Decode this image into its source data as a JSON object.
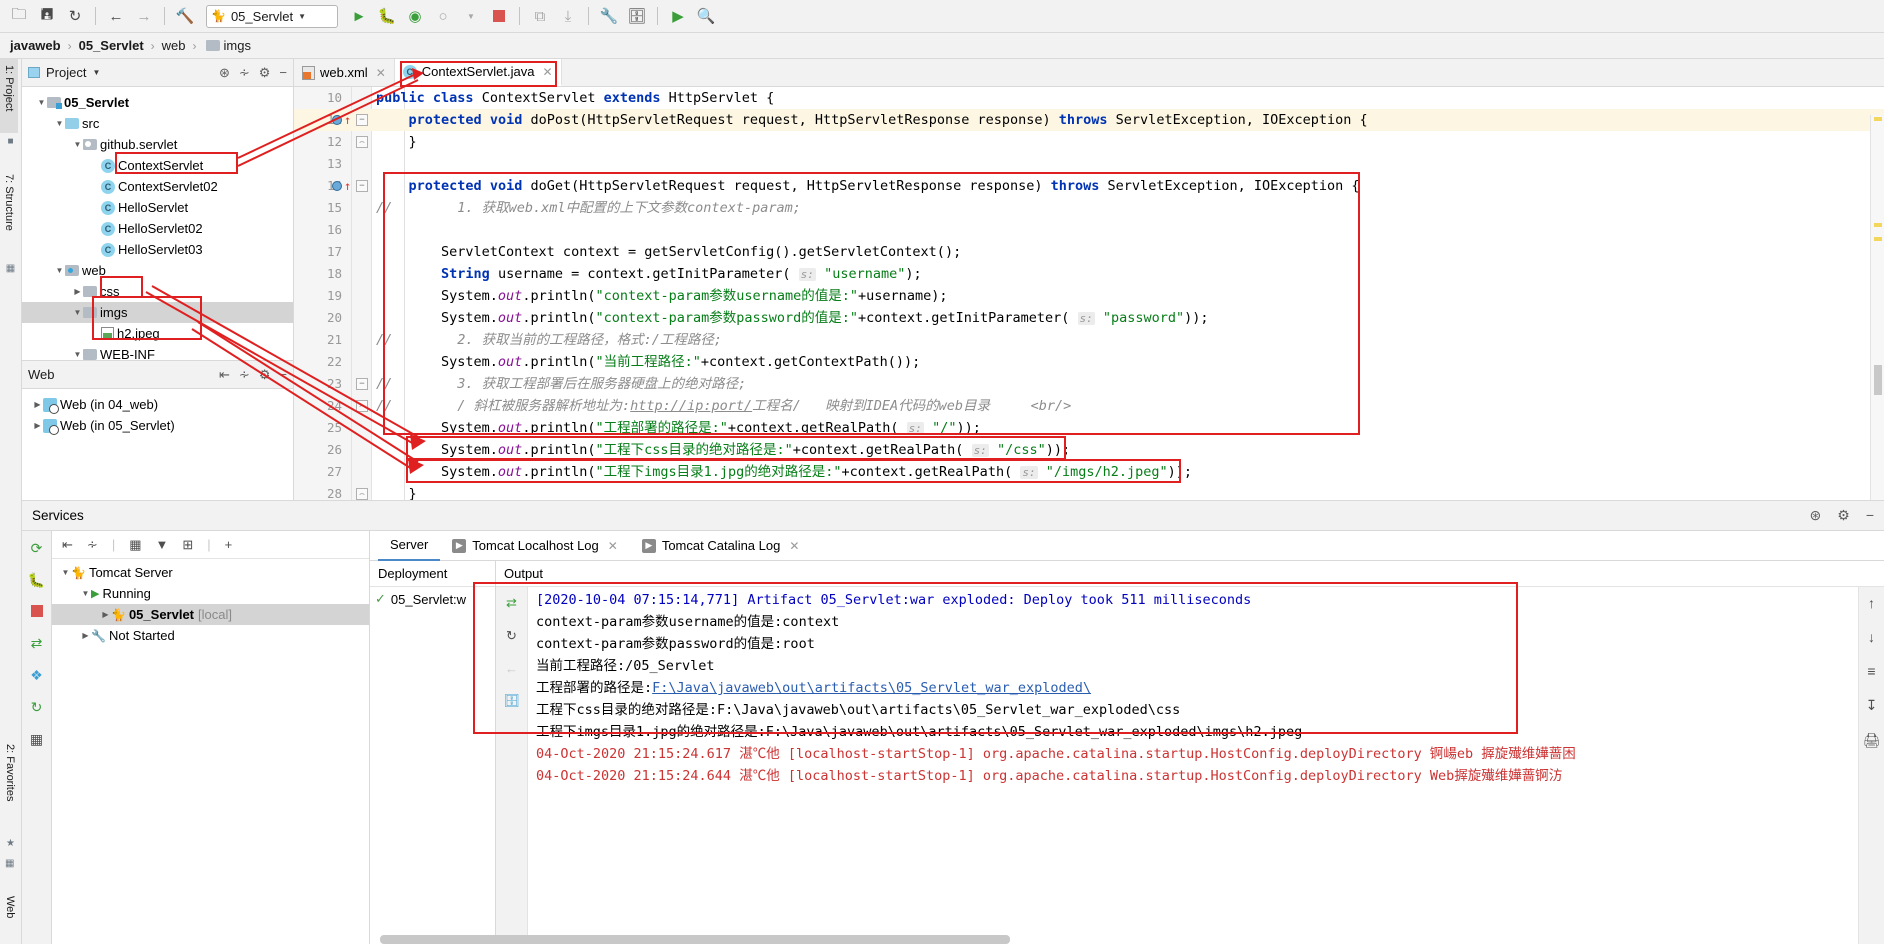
{
  "toolbar": {
    "icons": [
      "open-folder",
      "save-all",
      "sync",
      "back",
      "forward",
      "hammer",
      "run",
      "debug",
      "run-coverage",
      "profile",
      "stop",
      "update-app",
      "rerun",
      "wrench",
      "toolbar-window",
      "run-anything",
      "search-everywhere"
    ],
    "run_config": {
      "label": "05_Servlet",
      "caret": "▼"
    }
  },
  "breadcrumb": {
    "items": [
      "javaweb",
      "05_Servlet",
      "web",
      "imgs"
    ],
    "separator": "›"
  },
  "left_stripe": {
    "tabs": [
      "1: Project",
      "7: Structure"
    ]
  },
  "bottom_stripe": {
    "tabs": [
      "2: Favorites",
      "Web"
    ]
  },
  "project_panel": {
    "title": "Project",
    "caret": "▼",
    "tools": [
      "locate-icon",
      "collapse-all-icon",
      "settings-icon",
      "hide-icon"
    ],
    "tree": [
      {
        "label": "05_Servlet",
        "depth": 0,
        "twisty": "▼",
        "icon": "module-folder",
        "bold": true
      },
      {
        "label": "src",
        "depth": 1,
        "twisty": "▼",
        "icon": "source-folder",
        "bold": false
      },
      {
        "label": "github.servlet",
        "depth": 2,
        "twisty": "▼",
        "icon": "package-folder",
        "bold": false
      },
      {
        "label": "ContextServlet",
        "depth": 3,
        "twisty": "",
        "icon": "java-class",
        "bold": false
      },
      {
        "label": "ContextServlet02",
        "depth": 3,
        "twisty": "",
        "icon": "java-class",
        "bold": false
      },
      {
        "label": "HelloServlet",
        "depth": 3,
        "twisty": "",
        "icon": "java-class",
        "bold": false
      },
      {
        "label": "HelloServlet02",
        "depth": 3,
        "twisty": "",
        "icon": "java-class",
        "bold": false
      },
      {
        "label": "HelloServlet03",
        "depth": 3,
        "twisty": "",
        "icon": "java-class",
        "bold": false
      },
      {
        "label": "web",
        "depth": 1,
        "twisty": "▼",
        "icon": "web-folder",
        "bold": false
      },
      {
        "label": "css",
        "depth": 2,
        "twisty": "▶",
        "icon": "folder",
        "bold": false
      },
      {
        "label": "imgs",
        "depth": 2,
        "twisty": "▼",
        "icon": "folder",
        "bold": false,
        "selected": true
      },
      {
        "label": "h2.jpeg",
        "depth": 3,
        "twisty": "",
        "icon": "image-file",
        "bold": false
      },
      {
        "label": "WEB-INF",
        "depth": 2,
        "twisty": "▼",
        "icon": "folder",
        "bold": false
      }
    ]
  },
  "web_panel": {
    "title": "Web",
    "tools": [
      "expand-all-icon",
      "collapse-all-icon",
      "settings-icon",
      "hide-icon"
    ],
    "items": [
      {
        "label": "Web (in 04_web)",
        "twisty": "▶"
      },
      {
        "label": "Web (in 05_Servlet)",
        "twisty": "▶"
      }
    ]
  },
  "editor": {
    "tabs": [
      {
        "label": "web.xml",
        "icon": "xml-file-icon",
        "active": false
      },
      {
        "label": "ContextServlet.java",
        "icon": "java-class-icon",
        "active": true
      }
    ],
    "lines": [
      {
        "n": "10",
        "text": "public class ContextServlet extends HttpServlet {"
      },
      {
        "n": "11",
        "text": "    protected void doPost(HttpServletRequest request, HttpServletResponse response) throws ServletException, IOException {"
      },
      {
        "n": "12",
        "text": "    }"
      },
      {
        "n": "13",
        "text": ""
      },
      {
        "n": "14",
        "text": "    protected void doGet(HttpServletRequest request, HttpServletResponse response) throws ServletException, IOException {"
      },
      {
        "n": "15",
        "text": "//        1. 获取web.xml中配置的上下文参数context-param;"
      },
      {
        "n": "16",
        "text": ""
      },
      {
        "n": "17",
        "text": "        ServletContext context = getServletConfig().getServletContext();"
      },
      {
        "n": "18",
        "text": "        String username = context.getInitParameter( s: \"username\");"
      },
      {
        "n": "19",
        "text": "        System.out.println(\"context-param参数username的值是:\"+username);"
      },
      {
        "n": "20",
        "text": "        System.out.println(\"context-param参数password的值是:\"+context.getInitParameter( s: \"password\"));"
      },
      {
        "n": "21",
        "text": "//        2. 获取当前的工程路径，格式:/工程路径;"
      },
      {
        "n": "22",
        "text": "        System.out.println(\"当前工程路径:\"+context.getContextPath());"
      },
      {
        "n": "23",
        "text": "//        3. 获取工程部署后在服务器硬盘上的绝对路径;"
      },
      {
        "n": "24",
        "text": "//        / 斜杠被服务器解析地址为:http://ip:port/工程名/   映射到IDEA代码的web目录     <br/>"
      },
      {
        "n": "25",
        "text": "        System.out.println(\"工程部署的路径是:\"+context.getRealPath( s: \"/\"));"
      },
      {
        "n": "26",
        "text": "        System.out.println(\"工程下css目录的绝对路径是:\"+context.getRealPath( s: \"/css\"));"
      },
      {
        "n": "27",
        "text": "        System.out.println(\"工程下imgs目录1.jpg的绝对路径是:\"+context.getRealPath( s: \"/imgs/h2.jpeg\"));"
      },
      {
        "n": "28",
        "text": "    }"
      }
    ]
  },
  "services": {
    "title": "Services",
    "header_tools": [
      "help-icon",
      "settings-icon",
      "hide-icon"
    ],
    "left_strip_icons": [
      "rerun-icon",
      "debug-icon",
      "stop-icon",
      "redeploy-icon",
      "settings-diamond-icon",
      "restart-icon",
      "layout-icon"
    ],
    "tree_toolbar_icons": [
      "expand-all-icon",
      "collapse-all-icon",
      "group-icon",
      "filter-icon",
      "add-tab-icon",
      "add-icon"
    ],
    "tree": [
      {
        "label": "Tomcat Server",
        "depth": 0,
        "twisty": "▼",
        "icon": "tomcat-icon",
        "bold": false
      },
      {
        "label": "Running",
        "depth": 1,
        "twisty": "▼",
        "icon": "run-green-icon",
        "bold": false
      },
      {
        "label": "05_Servlet",
        "suffix": "[local]",
        "depth": 2,
        "twisty": "▶",
        "icon": "tomcat-icon",
        "bold": true,
        "selected": true
      },
      {
        "label": "Not Started",
        "depth": 1,
        "twisty": "▶",
        "icon": "wrench-icon",
        "bold": false
      }
    ],
    "tabs": [
      {
        "label": "Server",
        "icon": "",
        "active": true
      },
      {
        "label": "Tomcat Localhost Log",
        "icon": "console-icon",
        "active": false
      },
      {
        "label": "Tomcat Catalina Log",
        "icon": "console-icon",
        "active": false
      }
    ],
    "deployment_header": "Deployment",
    "output_header": "Output",
    "deployment_rows": [
      {
        "label": "05_Servlet:w",
        "status_icon": "check-icon"
      }
    ],
    "output_strip_icons": [
      "rerun-icon",
      "back-icon",
      "pin-icon"
    ],
    "right_rail_icons": [
      "up-icon",
      "down-icon",
      "wrap-icon",
      "scroll-end-icon",
      "print-icon"
    ],
    "console_lines": [
      {
        "text": "[2020-10-04 07:15:14,771] Artifact 05_Servlet:war exploded: Deploy took 511 milliseconds",
        "color": "blue"
      },
      {
        "text": "context-param参数username的值是:context",
        "color": "black"
      },
      {
        "text": "context-param参数password的值是:root",
        "color": "black"
      },
      {
        "text": "当前工程路径:/05_Servlet",
        "color": "black"
      },
      {
        "text": "工程部署的路径是:",
        "link": "F:\\Java\\javaweb\\out\\artifacts\\05_Servlet_war_exploded\\",
        "color": "black"
      },
      {
        "text": "工程下css目录的绝对路径是:F:\\Java\\javaweb\\out\\artifacts\\05_Servlet_war_exploded\\css",
        "color": "black"
      },
      {
        "text": "工程下imgs目录1.jpg的绝对路径是:F:\\Java\\javaweb\\out\\artifacts\\05_Servlet_war_exploded\\imgs\\h2.jpeg",
        "color": "black"
      },
      {
        "text": "04-Oct-2020 21:15:24.617 湛℃他 [localhost-startStop-1] org.apache.catalina.startup.HostConfig.deployDirectory 锕崵eb 搱旋殱维嬅蔷困",
        "color": "red"
      },
      {
        "text": "04-Oct-2020 21:15:24.644 湛℃他 [localhost-startStop-1] org.apache.catalina.startup.HostConfig.deployDirectory Web搱旋殱维嬅蔷锕汸",
        "color": "red"
      }
    ]
  },
  "annotation": {
    "color": "#e02020"
  }
}
